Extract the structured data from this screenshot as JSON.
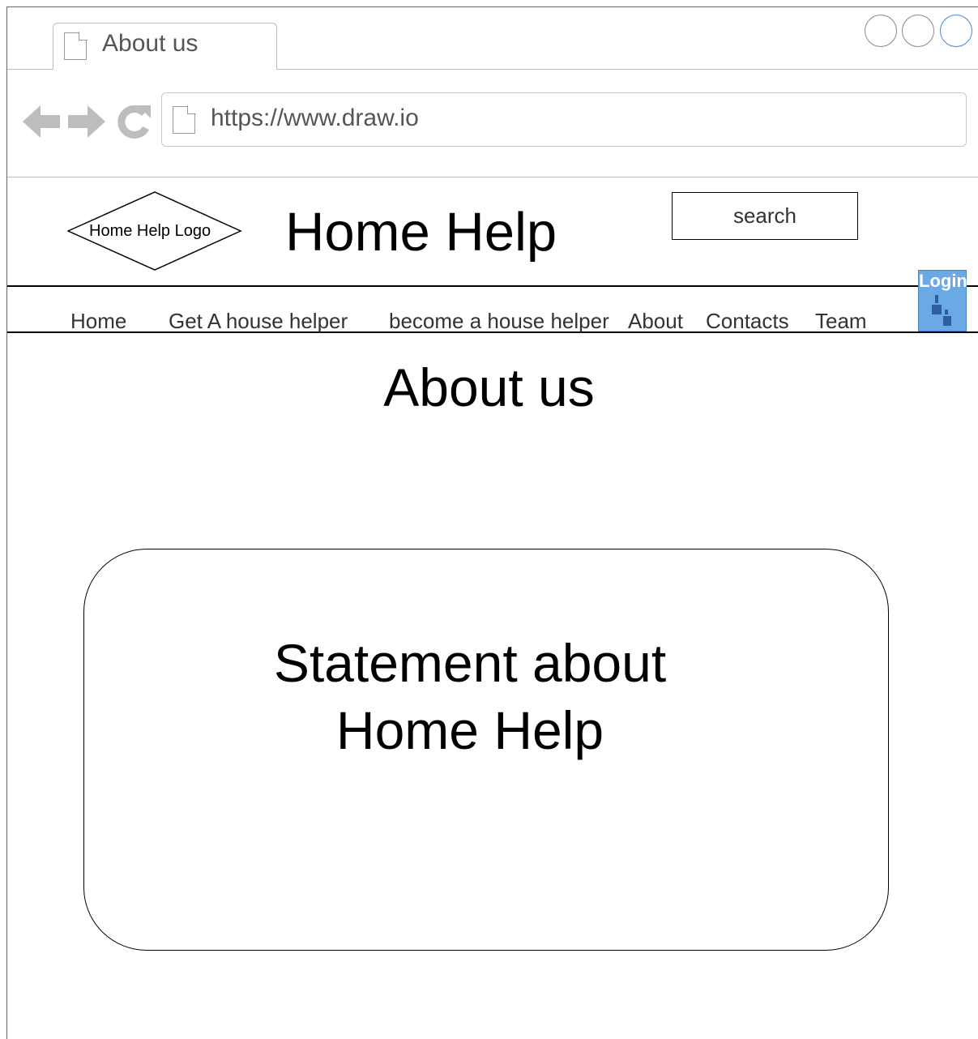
{
  "browser": {
    "tab_title": "About us",
    "url": "https://www.draw.io",
    "window_controls": [
      "minimize-circle",
      "maximize-circle",
      "close-circle"
    ],
    "nav_icons": [
      "back-arrow-icon",
      "forward-arrow-icon",
      "refresh-icon"
    ]
  },
  "header": {
    "logo_label": "Home Help Logo",
    "site_title": "Home Help",
    "search_label": "search"
  },
  "nav": {
    "items": [
      {
        "label": "Home"
      },
      {
        "label": "Get A house helper"
      },
      {
        "label": "become a house helper"
      },
      {
        "label": "About"
      },
      {
        "label": "Contacts"
      },
      {
        "label": "Team"
      }
    ],
    "login_label": "Login",
    "login_color": "#6aa9e6"
  },
  "main": {
    "heading": "About us",
    "statement": "Statement about Home Help"
  }
}
